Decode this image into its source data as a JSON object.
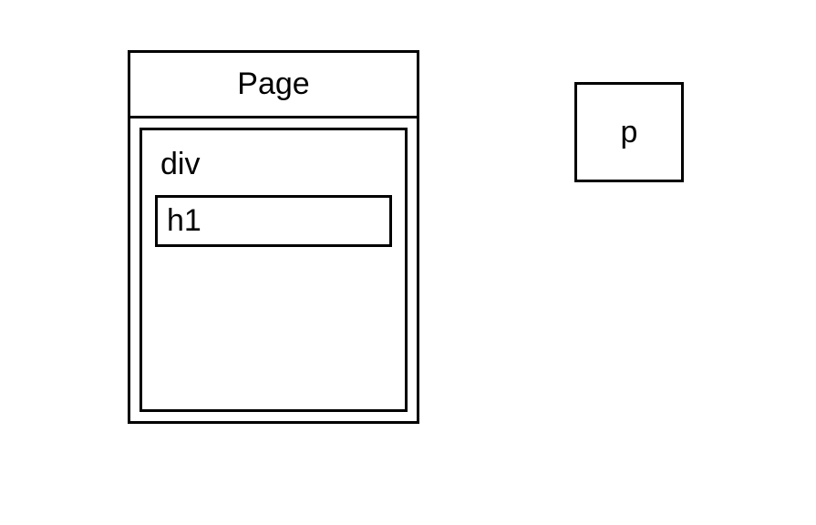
{
  "diagram": {
    "page_label": "Page",
    "div_label": "div",
    "h1_label": "h1",
    "p_label": "p"
  }
}
